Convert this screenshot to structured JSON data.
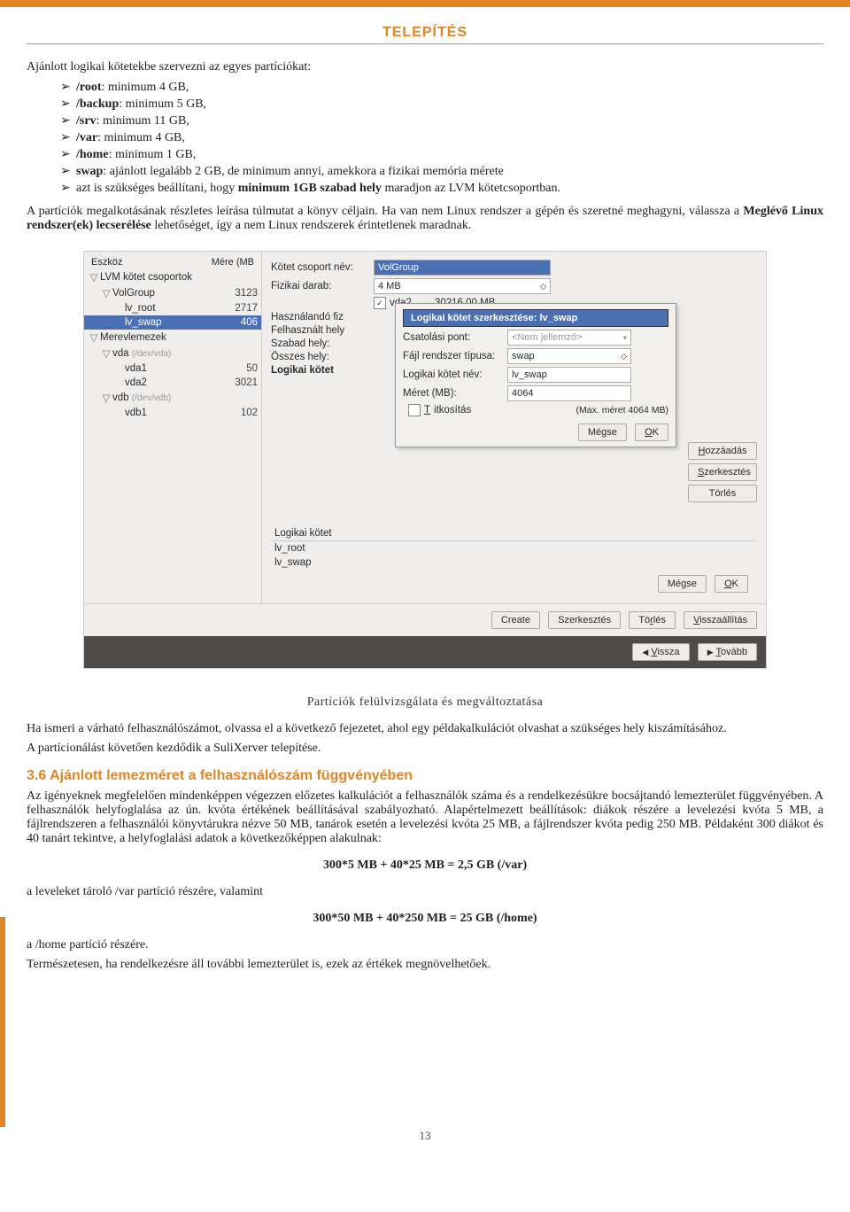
{
  "header": "TELEPÍTÉS",
  "intro": "Ajánlott logikai kötetekbe szervezni az egyes partíciókat:",
  "bullets": [
    {
      "b": "/root",
      "t": ": minimum 4 GB,"
    },
    {
      "b": "/backup",
      "t": ": minimum 5 GB,"
    },
    {
      "b": "/srv",
      "t": ": minimum 11 GB,"
    },
    {
      "b": "/var",
      "t": ": minimum 4 GB,"
    },
    {
      "b": "/home",
      "t": ": minimum 1 GB,"
    },
    {
      "b": "swap",
      "t": ": ajánlott legalább 2 GB, de minimum annyi, amekkora a fizikai memória mérete"
    },
    {
      "b": "",
      "t": "azt is szükséges beállítani, hogy",
      "b2": "minimum 1GB szabad hely",
      "t2": " maradjon az LVM kötetcsoportban."
    }
  ],
  "para1a": "A partíciók megalkotásának részletes leírása túlmutat a könyv céljain. Ha van nem Linux rendszer a gépén és szeretné meghagyni, válassza a ",
  "para1b": "Meglévő Linux rendszer(ek) lecserélése",
  "para1c": " lehetőséget, így a nem Linux rendszerek érintetlenek maradnak.",
  "shot": {
    "dev_h1": "Eszköz",
    "dev_h2": "Mére\n(MB",
    "tree": [
      {
        "l": 0,
        "tw": "▽",
        "t": "LVM kötet csoportok",
        "n": ""
      },
      {
        "l": 1,
        "tw": "▽",
        "t": "VolGroup",
        "n": "3123"
      },
      {
        "l": 2,
        "tw": "",
        "t": "lv_root",
        "n": "2717"
      },
      {
        "l": 2,
        "tw": "",
        "t": "lv_swap",
        "n": "406",
        "sel": true
      },
      {
        "l": 0,
        "tw": "▽",
        "t": "Merevlemezek",
        "n": ""
      },
      {
        "l": 1,
        "tw": "▽",
        "t": "vda",
        "faded": "(/dev/vda)",
        "n": ""
      },
      {
        "l": 2,
        "tw": "",
        "t": "vda1",
        "n": "50"
      },
      {
        "l": 2,
        "tw": "",
        "t": "vda2",
        "n": "3021"
      },
      {
        "l": 1,
        "tw": "▽",
        "t": "vdb",
        "faded": "(/dev/vdb)",
        "n": ""
      },
      {
        "l": 2,
        "tw": "",
        "t": "vdb1",
        "n": "102"
      }
    ],
    "vgname_l": "Kötet csoport név:",
    "vgname_v": "VolGroup",
    "pe_l": "Fizikai darab:",
    "pe_v": "4 MB",
    "pv_chk": "vda2",
    "pv_size": "30216.00 MB",
    "usephys": "Használandó fiz",
    "used_l": "Felhasznált hely",
    "free_l": "Szabad hely:",
    "total_l": "Összes hely:",
    "lvhead": "Logikai kötet",
    "lv_list_h": "Logikai kötet",
    "lv_list": [
      "lv_root",
      "lv_swap"
    ],
    "dlg_title": "Logikai kötet szerkesztése: lv_swap",
    "mount_l": "Csatolási pont:",
    "mount_v": "<Nem jellemző>",
    "fstype_l": "Fájl rendszer típusa:",
    "fstype_v": "swap",
    "lvname_l": "Logikai kötet név:",
    "lvname_v": "lv_swap",
    "size_l": "Méret (MB):",
    "size_v": "4064",
    "enc_l": "Titkosítás",
    "max_l": "(Max. méret 4064 MB)",
    "cancel": "Mégse",
    "ok": "OK",
    "side": [
      "Hozzáadás",
      "Szerkesztés",
      "Törlés"
    ],
    "mid_cancel": "Mégse",
    "mid_ok": "OK",
    "bottom": [
      "Create",
      "Szerkesztés",
      "Törlés",
      "Visszaállítás"
    ],
    "back": "Vissza",
    "next": "Tovább"
  },
  "caption": "Partíciók felülvizsgálata és megváltoztatása",
  "para2": "Ha ismeri a várható felhasználószámot, olvassa el a következő fejezetet, ahol egy példakalkulációt olvashat a szükséges hely kiszámításához.",
  "para3": "A partícionálást követően kezdődik a SuliXerver telepítése.",
  "section": "3.6 Ajánlott lemezméret a felhasználószám függvényében",
  "para4": "Az igényeknek megfelelően mindenképpen végezzen előzetes kalkulációt a felhasználók száma és a rendelkezésükre bocsájtandó lemezterület függvényében. A felhasználók helyfoglalása az ún. kvóta értékének beállításával szabályozható. Alapértelmezett beállítások: diákok részére a levelezési kvóta 5 MB, a fájlrendszeren a felhasználói könyvtárukra nézve 50 MB, tanárok esetén a levelezési kvóta 25 MB, a fájlrendszer kvóta pedig 250 MB. Példaként 300 diákot és 40 tanárt tekintve, a helyfoglalási adatok a következőképpen alakulnak:",
  "formula1": "300*5 MB + 40*25 MB = 2,5 GB (/var)",
  "para5": "a leveleket tároló /var partíció részére, valamint",
  "formula2": "300*50 MB + 40*250 MB = 25 GB (/home)",
  "para6": "a /home partíció részére.",
  "para7": "Természetesen, ha rendelkezésre áll további lemezterület is, ezek az értékek megnövelhetőek.",
  "pagenum": "13"
}
